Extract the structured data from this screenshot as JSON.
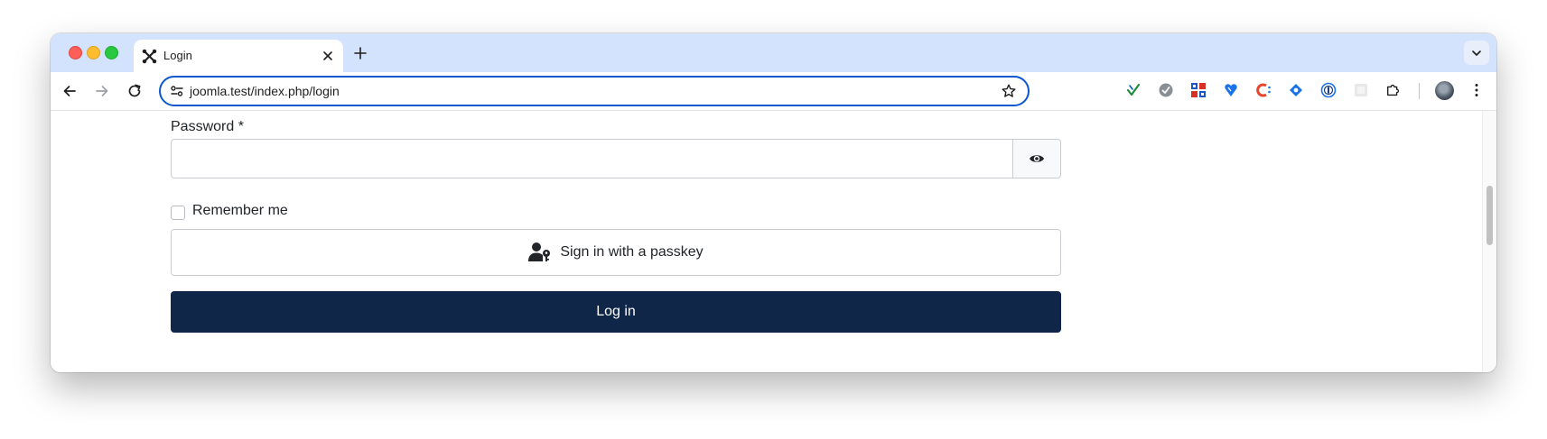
{
  "browser": {
    "tab": {
      "title": "Login"
    },
    "address_bar": {
      "url": "joomla.test/index.php/login"
    }
  },
  "form": {
    "password": {
      "label": "Password *",
      "value": ""
    },
    "remember_me": {
      "label": "Remember me",
      "checked": false
    },
    "passkey_button": {
      "label": "Sign in with a passkey"
    },
    "login_button": {
      "label": "Log in"
    }
  },
  "colors": {
    "tabstrip": "#d3e3fd",
    "login_button": "#0f2649",
    "omnibox_focus": "#0b57d0"
  }
}
